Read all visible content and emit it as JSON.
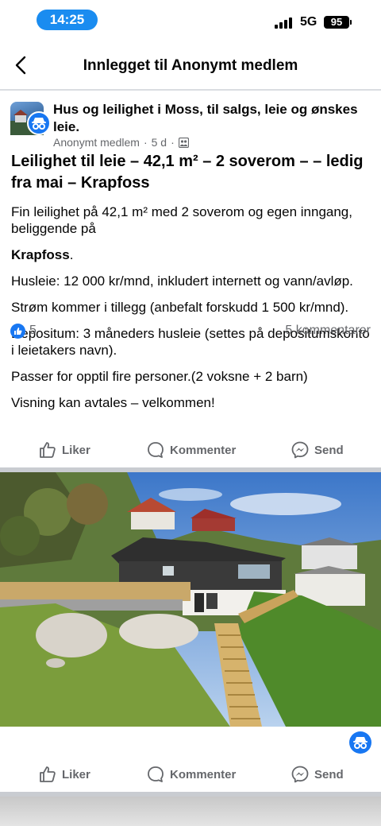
{
  "status_bar": {
    "time": "14:25",
    "network": "5G",
    "battery": "95"
  },
  "header": {
    "title": "Innlegget til Anonymt medlem"
  },
  "post": {
    "group_name": "Hus og leilighet i Moss, til salgs, leie og ønskes leie.",
    "author": "Anonymt medlem",
    "age": "5 d",
    "title": "Leilighet til leie – 42,1 m² – 2 soverom – – ledig fra mai – Krapfoss",
    "body": {
      "p1": "Fin leilighet på 42,1 m² med 2 soverom og egen inngang, beliggende på",
      "p2": "Krapfoss",
      "p2_suffix": ".",
      "p3": "Husleie: 12 000 kr/mnd, inkludert internett og vann/avløp.",
      "p4": "Strøm kommer i tillegg (anbefalt forskudd 1 500 kr/mnd).",
      "p5": "Depositum: 3 måneders husleie (settes på depositumskonto i leietakers navn).",
      "p6": "Passer for opptil fire personer.(2 voksne + 2 barn)",
      "p7": "Visning kan avtales – velkommen!"
    },
    "reaction_count": "5",
    "comment_count": "5 kommentarer"
  },
  "actions": {
    "like": "Liker",
    "comment": "Kommenter",
    "send": "Send"
  },
  "colors": {
    "accent": "#1877f2",
    "status_pill": "#1a8cf0",
    "secondary_text": "#65676b"
  },
  "icons": [
    "back-chevron-icon",
    "like-thumb-icon",
    "comment-bubble-icon",
    "messenger-icon",
    "anonymous-icon",
    "globe-group-icon"
  ]
}
